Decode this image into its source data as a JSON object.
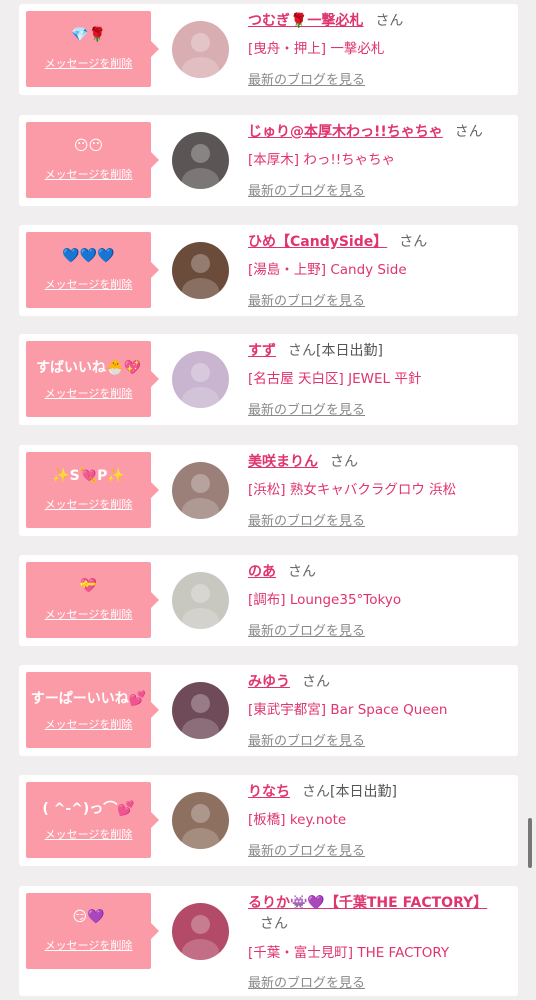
{
  "cards": [
    {
      "message": "💎🌹",
      "delete_label": "メッセージを削除",
      "name": "つむぎ🌹一撃必札",
      "honorific": "さん",
      "status": "",
      "shop": "[曳舟・押上] 一撃必札",
      "blog_link": "最新のブログを見る",
      "avatar_color": "#d9aeb2"
    },
    {
      "message": "😶😶",
      "delete_label": "メッセージを削除",
      "name": "じゅり@本厚木わっ!!ちゃちゃ",
      "honorific": "さん",
      "status": "",
      "shop": "[本厚木] わっ!!ちゃちゃ",
      "blog_link": "最新のブログを見る",
      "avatar_color": "#5b5555"
    },
    {
      "message": "💙💙💙",
      "delete_label": "メッセージを削除",
      "name": "ひめ【CandySide】",
      "honorific": "さん",
      "status": "",
      "shop": "[湯島・上野] Candy Side",
      "blog_link": "最新のブログを見る",
      "avatar_color": "#6b4c3a"
    },
    {
      "message": "すばいいね🐣💖",
      "delete_label": "メッセージを削除",
      "name": "すず",
      "honorific": "さん",
      "status": "[本日出勤]",
      "shop": "[名古屋 天白区] JEWEL 平針",
      "blog_link": "最新のブログを見る",
      "avatar_color": "#c9b5cf"
    },
    {
      "message": "✨S💘P✨",
      "delete_label": "メッセージを削除",
      "name": "美咲まりん",
      "honorific": "さん",
      "status": "",
      "shop": "[浜松] 熟女キャバクラグロウ 浜松",
      "blog_link": "最新のブログを見る",
      "avatar_color": "#9a8078"
    },
    {
      "message": "💝",
      "delete_label": "メッセージを削除",
      "name": "のあ",
      "honorific": "さん",
      "status": "",
      "shop": "[調布] Lounge35°Tokyo",
      "blog_link": "最新のブログを見る",
      "avatar_color": "#c8c7c0"
    },
    {
      "message": "すーぱーいいね💕",
      "delete_label": "メッセージを削除",
      "name": "みゆう",
      "honorific": "さん",
      "status": "",
      "shop": "[東武宇都宮] Bar Space Queen",
      "blog_link": "最新のブログを見る",
      "avatar_color": "#6f4a58"
    },
    {
      "message": "( ^-^)っ⌒💕",
      "delete_label": "メッセージを削除",
      "name": "りなち",
      "honorific": "さん",
      "status": "[本日出勤]",
      "shop": "[板橋] key.note",
      "blog_link": "最新のブログを見る",
      "avatar_color": "#8e7060"
    },
    {
      "message": "😏💜",
      "delete_label": "メッセージを削除",
      "name": "るりか👾💜【千葉THE FACTORY】",
      "honorific": "さん",
      "status": "",
      "shop": "[千葉・富士見町] THE FACTORY",
      "blog_link": "最新のブログを見る",
      "avatar_color": "#b24a68"
    }
  ]
}
